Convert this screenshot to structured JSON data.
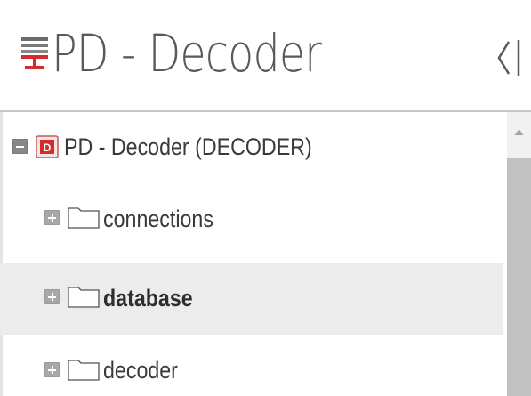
{
  "header": {
    "title": "PD - Decoder",
    "icon": "server-icon",
    "collapse_icon": "collapse-left-icon"
  },
  "tree": {
    "root": {
      "label": "PD - Decoder (DECODER)",
      "expanded": true,
      "icon": "decoder-device-icon",
      "icon_letter": "D"
    },
    "items": [
      {
        "label": "connections",
        "expanded": false,
        "icon": "folder-icon",
        "selected": false
      },
      {
        "label": "database",
        "expanded": false,
        "icon": "folder-icon",
        "selected": true
      },
      {
        "label": "decoder",
        "expanded": false,
        "icon": "folder-icon",
        "selected": false
      }
    ]
  },
  "colors": {
    "accent_red": "#d42c2c",
    "selected_row": "#ececec",
    "title_text": "#555a5f"
  }
}
